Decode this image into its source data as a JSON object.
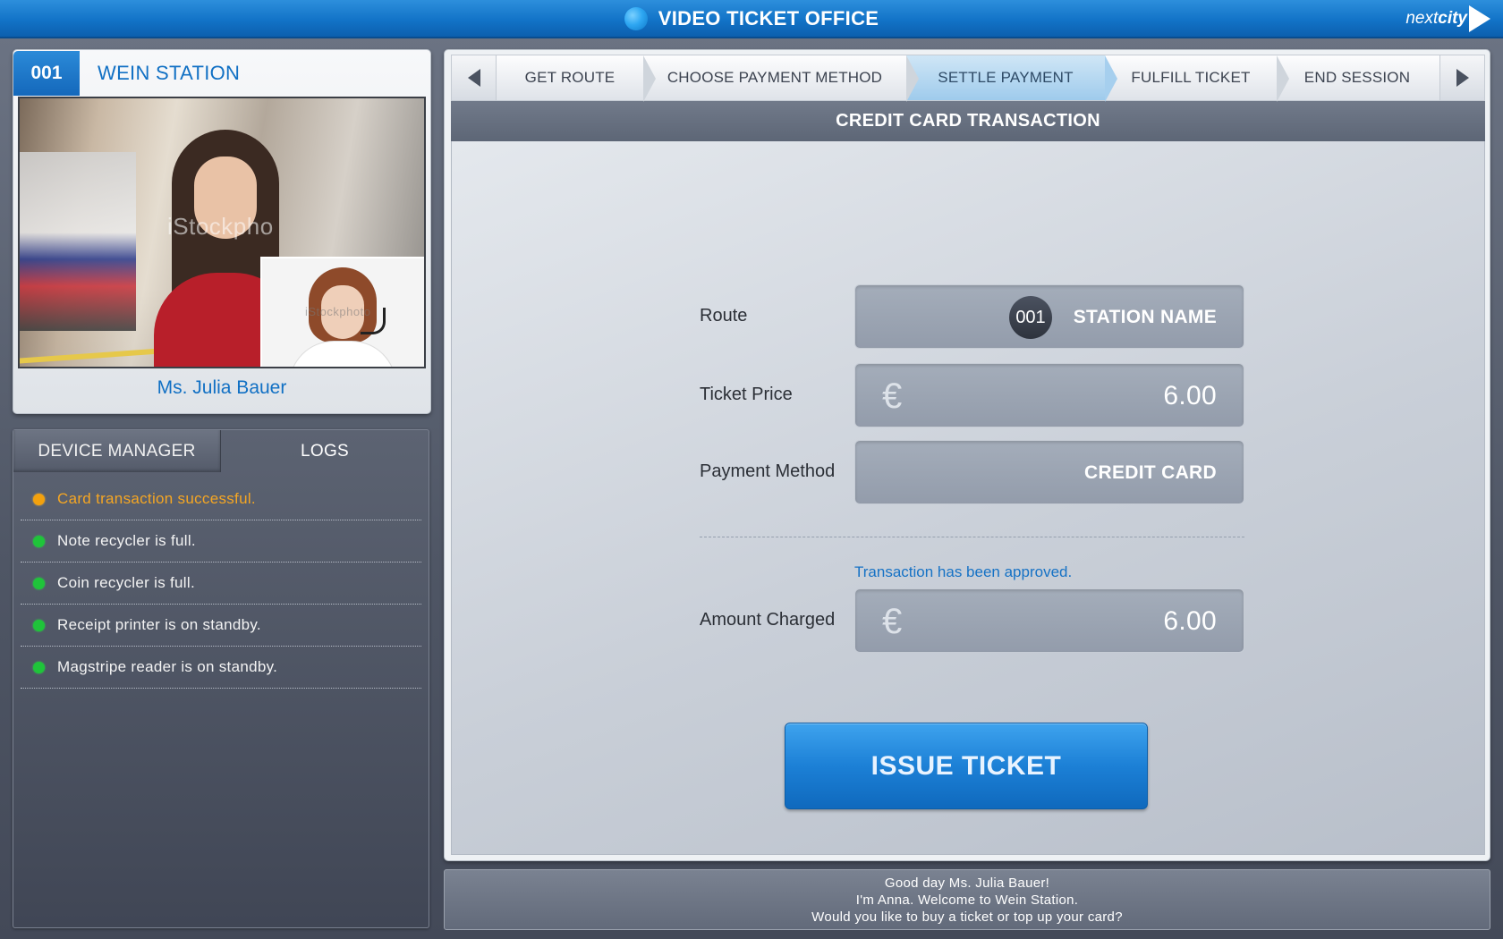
{
  "app": {
    "title": "VIDEO TICKET OFFICE",
    "brand_prefix": "next",
    "brand_suffix": "city"
  },
  "caller": {
    "station_code": "001",
    "station_name": "WEIN STATION",
    "customer_name": "Ms. Julia Bauer",
    "watermark": "iStockpho",
    "pip_watermark": "iStockphoto"
  },
  "device_panel": {
    "tabs": [
      {
        "label": "DEVICE MANAGER",
        "active": false
      },
      {
        "label": "LOGS",
        "active": true
      }
    ],
    "logs": [
      {
        "text": "Card transaction successful.",
        "status": "warning",
        "color": "#f3a10d"
      },
      {
        "text": "Note recycler is full.",
        "status": "ok",
        "color": "#1fc43a"
      },
      {
        "text": "Coin recycler is full.",
        "status": "ok",
        "color": "#1fc43a"
      },
      {
        "text": "Receipt printer is on standby.",
        "status": "ok",
        "color": "#1fc43a"
      },
      {
        "text": "Magstripe reader is on standby.",
        "status": "ok",
        "color": "#1fc43a"
      }
    ]
  },
  "steps": {
    "prev_icon": "chevron-left-icon",
    "next_icon": "chevron-right-icon",
    "items": [
      {
        "label": "GET ROUTE",
        "active": false
      },
      {
        "label": "CHOOSE PAYMENT METHOD",
        "active": false
      },
      {
        "label": "SETTLE PAYMENT",
        "active": true
      },
      {
        "label": "FULFILL TICKET",
        "active": false
      },
      {
        "label": "END SESSION",
        "active": false
      }
    ]
  },
  "transaction": {
    "section_title": "CREDIT CARD TRANSACTION",
    "route_label": "Route",
    "route_code": "001",
    "route_value": "STATION NAME",
    "ticket_price_label": "Ticket Price",
    "currency_symbol": "€",
    "ticket_price_value": "6.00",
    "payment_method_label": "Payment Method",
    "payment_method_value": "CREDIT CARD",
    "approved_message": "Transaction has been approved.",
    "amount_charged_label": "Amount Charged",
    "amount_charged_value": "6.00",
    "issue_button": "ISSUE TICKET"
  },
  "speech": {
    "lines": [
      "Good day Ms. Julia Bauer!",
      "I'm Anna. Welcome to Wein Station.",
      "Would you like to buy a ticket or top up your card?"
    ]
  },
  "colors": {
    "accent_blue": "#1273c7",
    "active_step": "#9fcbec",
    "ok_led": "#1fc43a",
    "warn_led": "#f3a10d"
  }
}
